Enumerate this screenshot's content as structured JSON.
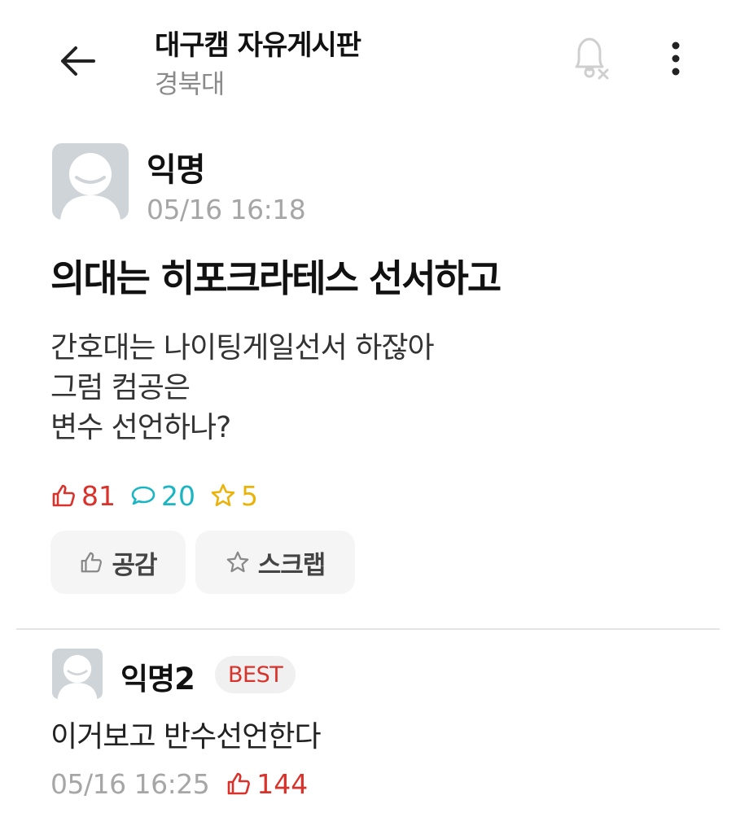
{
  "header": {
    "board_title": "대구캠 자유게시판",
    "school": "경북대"
  },
  "post": {
    "author": "익명",
    "time": "05/16 16:18",
    "title": "의대는 히포크라테스 선서하고",
    "body": [
      "간호대는 나이팅게일선서 하잖아",
      "그럼 컴공은",
      "변수 선언하나?"
    ],
    "likes": "81",
    "comments": "20",
    "scraps": "5"
  },
  "actions": {
    "like_label": "공감",
    "scrap_label": "스크랩"
  },
  "comment": {
    "author": "익명2",
    "badge": "BEST",
    "text": "이거보고 반수선언한다",
    "time": "05/16 16:25",
    "likes": "144"
  },
  "colors": {
    "like": "#d8322b",
    "comment": "#1ab5c2",
    "scrap": "#e9b30b",
    "muted": "#a6a6a6"
  },
  "icons": [
    "back-arrow-icon",
    "bell-off-icon",
    "more-vertical-icon",
    "thumbs-up-icon",
    "speech-bubble-icon",
    "star-icon",
    "avatar-icon"
  ]
}
